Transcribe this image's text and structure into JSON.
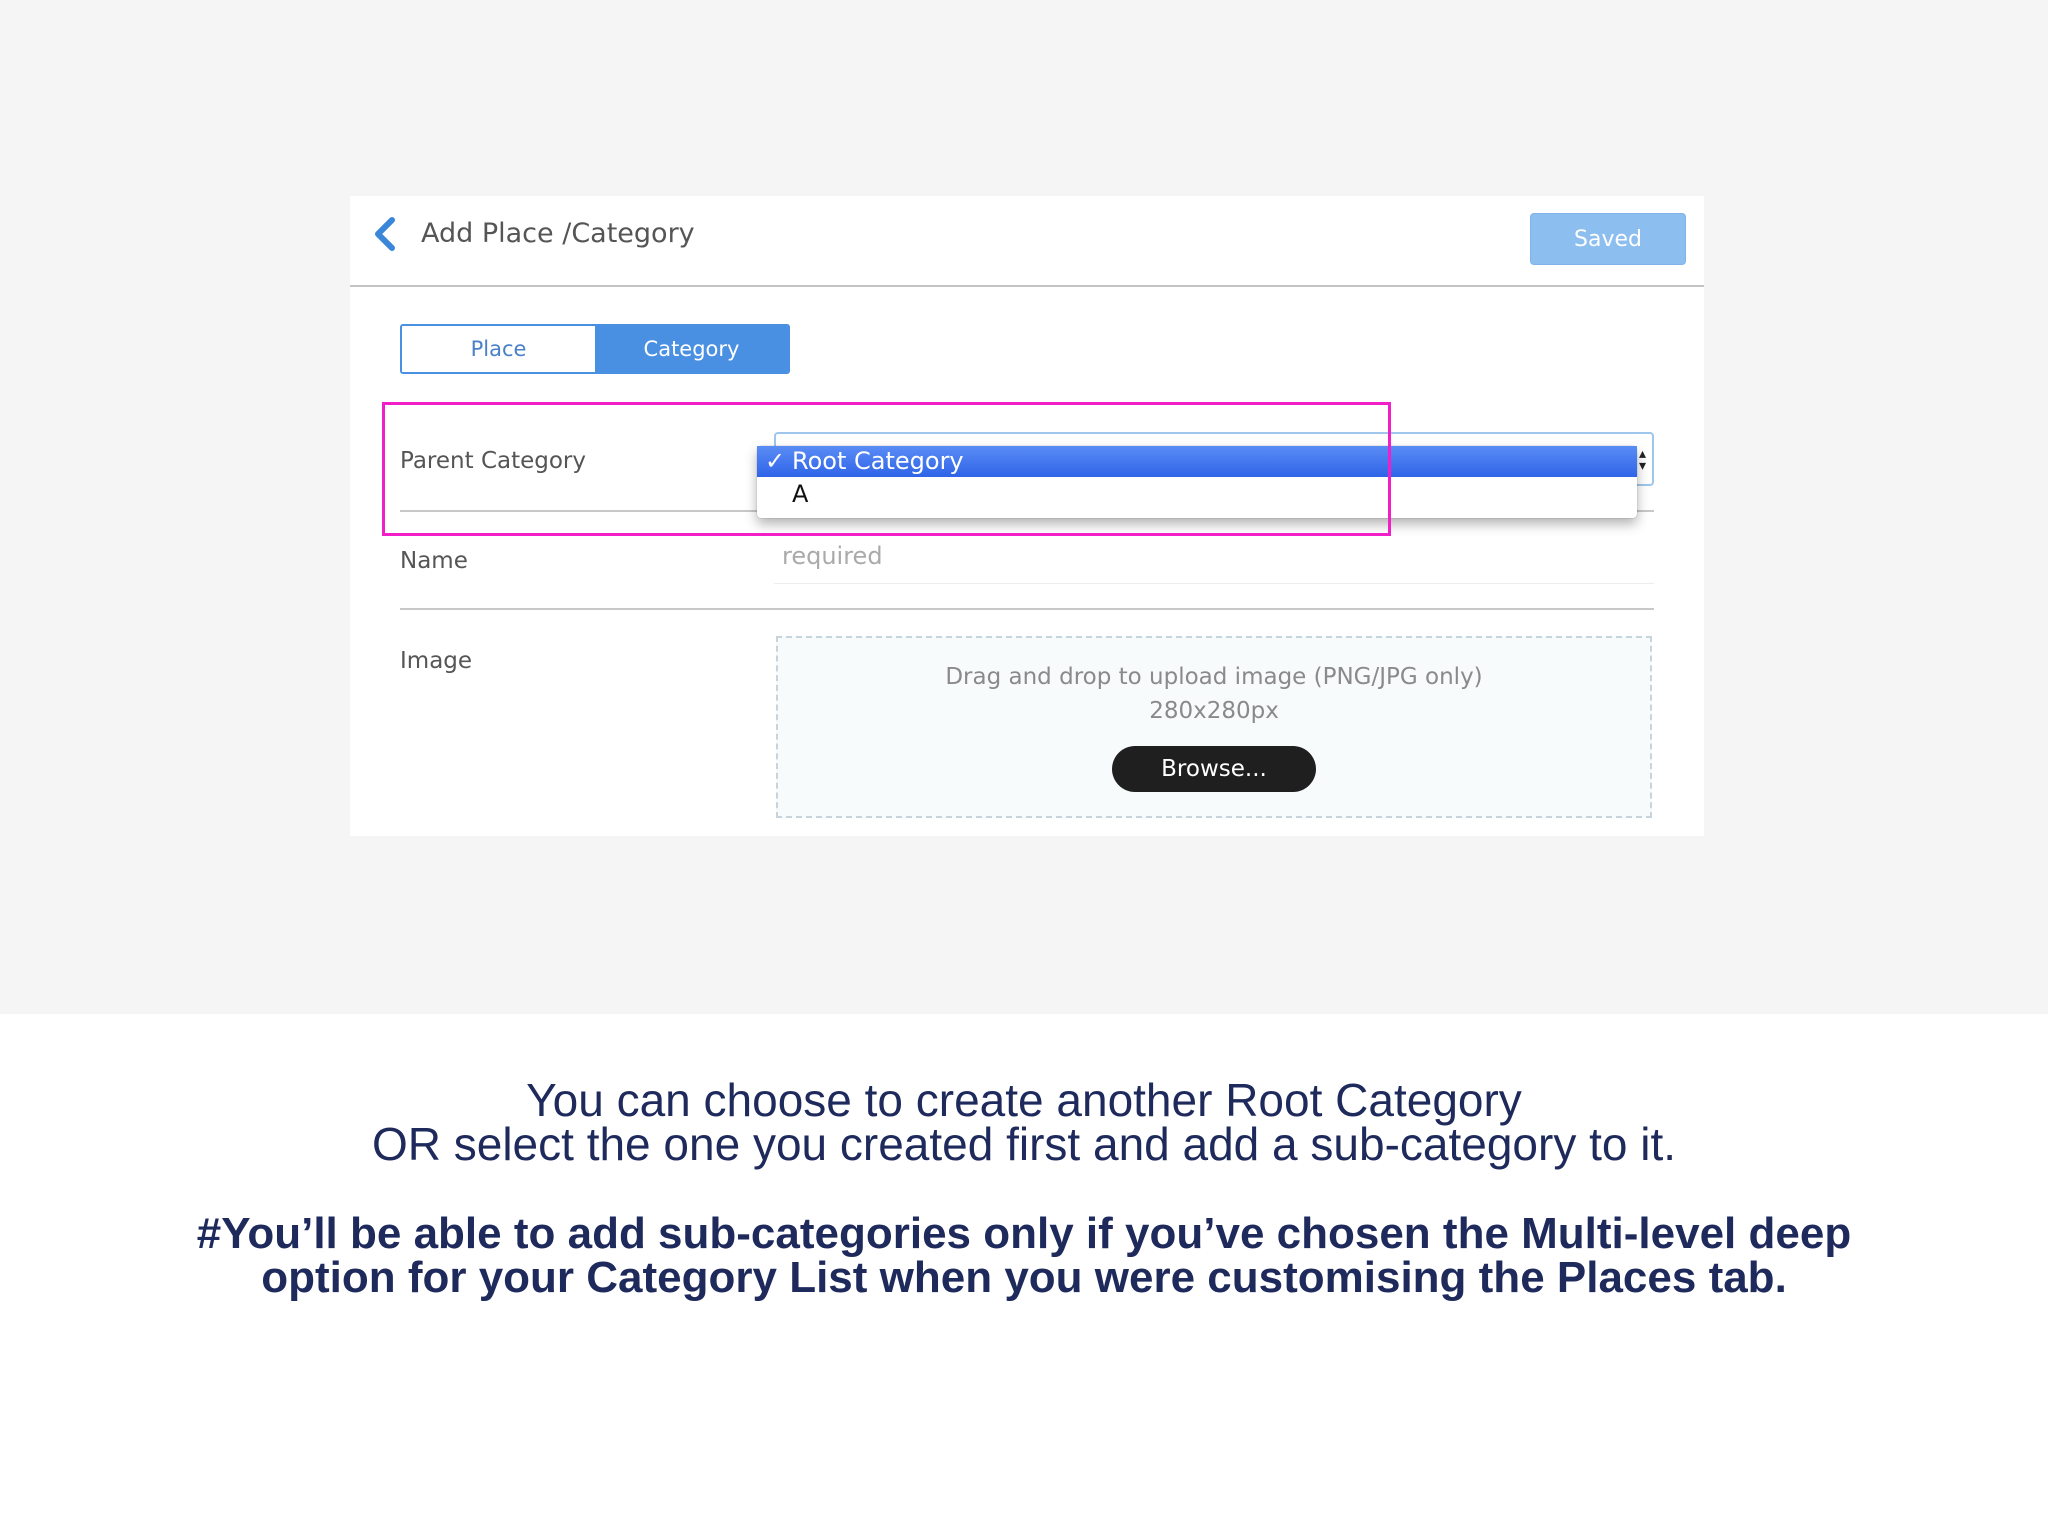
{
  "header": {
    "title": "Add Place /Category",
    "saved_label": "Saved"
  },
  "tabs": [
    {
      "label": "Place",
      "active": false
    },
    {
      "label": "Category",
      "active": true
    }
  ],
  "form": {
    "parent_category": {
      "label": "Parent Category",
      "options": [
        {
          "label": "Root Category",
          "selected": true,
          "check": "✓"
        },
        {
          "label": "A",
          "selected": false
        }
      ]
    },
    "name": {
      "label": "Name",
      "placeholder": "required"
    },
    "image": {
      "label": "Image",
      "dropzone_line1": "Drag and drop to upload image (PNG/JPG only)",
      "dropzone_line2": "280x280px",
      "browse_label": "Browse..."
    }
  },
  "caption": {
    "line1": "You can choose to create another Root Category",
    "line2": "OR select the one you created first and add a sub-category to it.",
    "note_line1": "#You’ll be able to add sub-categories only if you’ve chosen the Multi-level deep",
    "note_line2": "option for your Category List when you were customising the Places tab."
  },
  "colors": {
    "accent": "#4a90e2",
    "saved_button": "#8cbef0",
    "highlight": "#f01fc8",
    "caption_text": "#1f2a5c"
  },
  "icons": {
    "back": "chevron-left-icon",
    "select_arrows": "select-arrows-icon",
    "check": "checkmark-icon"
  }
}
